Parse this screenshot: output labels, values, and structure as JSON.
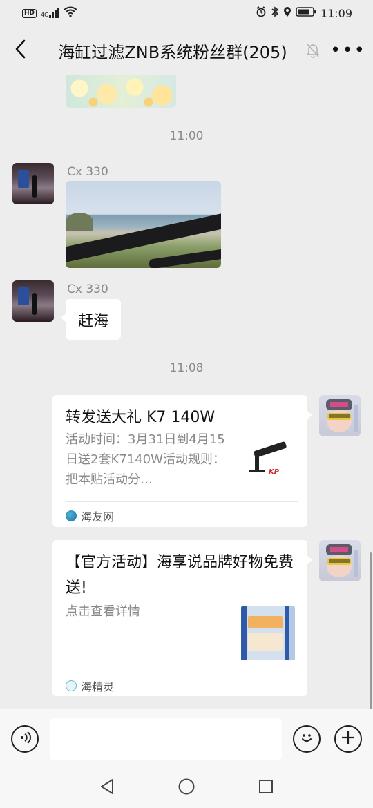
{
  "status_bar": {
    "hd": "HD",
    "network": "4G",
    "time": "11:09"
  },
  "header": {
    "title": "海缸过滤ZNB系统粉丝群(205)",
    "more": "•••"
  },
  "messages": [
    {
      "type": "time",
      "text": "11:00"
    },
    {
      "type": "image",
      "sender": "Cx 330"
    },
    {
      "type": "text",
      "sender": "Cx 330",
      "text": "赶海"
    },
    {
      "type": "time",
      "text": "11:08"
    },
    {
      "type": "link-card",
      "title": "转发送大礼 K7 140W",
      "description": "活动时间：3月31日到4月15日送2套K7140W活动规则：把本贴活动分…",
      "thumb_brand": "KP",
      "source": "海友网"
    },
    {
      "type": "link-card",
      "title": "【官方活动】海享说品牌好物免费送!",
      "description": "点击查看详情",
      "source": "海精灵"
    }
  ],
  "input_bar": {
    "placeholder": ""
  },
  "icons": {
    "back": "chevron-left-icon",
    "mute": "bell-off-icon",
    "voice": "voice-icon",
    "emoji": "emoji-icon",
    "plus": "plus-icon"
  }
}
